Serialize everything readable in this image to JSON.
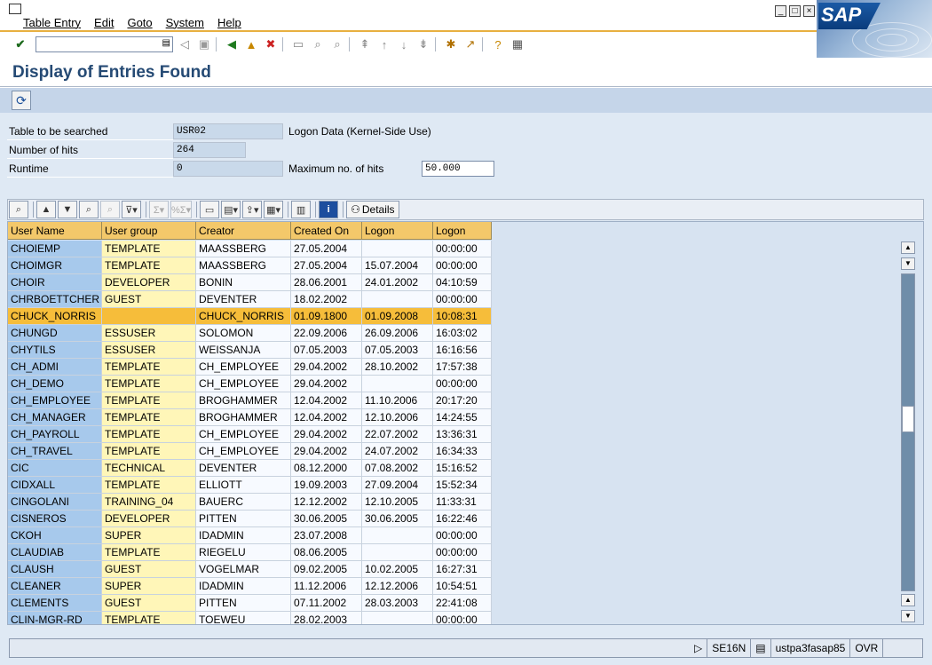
{
  "menubar": {
    "items": [
      "Table Entry",
      "Edit",
      "Goto",
      "System",
      "Help"
    ],
    "logo_text": "SAP"
  },
  "toolbar": {
    "command_value": ""
  },
  "page": {
    "title": "Display of Entries Found"
  },
  "fields": {
    "table_label": "Table to be searched",
    "table_value": "USR02",
    "table_desc": "Logon Data (Kernel-Side Use)",
    "hits_label": "Number of hits",
    "hits_value": "264",
    "runtime_label": "Runtime",
    "runtime_value": "0",
    "max_label": "Maximum no. of hits",
    "max_value": "50.000"
  },
  "alv": {
    "details_label": "Details"
  },
  "table": {
    "headers": [
      "User Name",
      "User group",
      "Creator",
      "Created On",
      "Logon",
      "Logon"
    ],
    "rows": [
      [
        "CHOIEMP",
        "TEMPLATE",
        "MAASSBERG",
        "27.05.2004",
        "",
        "00:00:00"
      ],
      [
        "CHOIMGR",
        "TEMPLATE",
        "MAASSBERG",
        "27.05.2004",
        "15.07.2004",
        "00:00:00"
      ],
      [
        "CHOIR",
        "DEVELOPER",
        "BONIN",
        "28.06.2001",
        "24.01.2002",
        "04:10:59"
      ],
      [
        "CHRBOETTCHER",
        "GUEST",
        "DEVENTER",
        "18.02.2002",
        "",
        "00:00:00"
      ],
      [
        "CHUCK_NORRIS",
        "",
        "CHUCK_NORRIS",
        "01.09.1800",
        "01.09.2008",
        "10:08:31"
      ],
      [
        "CHUNGD",
        "ESSUSER",
        "SOLOMON",
        "22.09.2006",
        "26.09.2006",
        "16:03:02"
      ],
      [
        "CHYTILS",
        "ESSUSER",
        "WEISSANJA",
        "07.05.2003",
        "07.05.2003",
        "16:16:56"
      ],
      [
        "CH_ADMI",
        "TEMPLATE",
        "CH_EMPLOYEE",
        "29.04.2002",
        "28.10.2002",
        "17:57:38"
      ],
      [
        "CH_DEMO",
        "TEMPLATE",
        "CH_EMPLOYEE",
        "29.04.2002",
        "",
        "00:00:00"
      ],
      [
        "CH_EMPLOYEE",
        "TEMPLATE",
        "BROGHAMMER",
        "12.04.2002",
        "11.10.2006",
        "20:17:20"
      ],
      [
        "CH_MANAGER",
        "TEMPLATE",
        "BROGHAMMER",
        "12.04.2002",
        "12.10.2006",
        "14:24:55"
      ],
      [
        "CH_PAYROLL",
        "TEMPLATE",
        "CH_EMPLOYEE",
        "29.04.2002",
        "22.07.2002",
        "13:36:31"
      ],
      [
        "CH_TRAVEL",
        "TEMPLATE",
        "CH_EMPLOYEE",
        "29.04.2002",
        "24.07.2002",
        "16:34:33"
      ],
      [
        "CIC",
        "TECHNICAL",
        "DEVENTER",
        "08.12.2000",
        "07.08.2002",
        "15:16:52"
      ],
      [
        "CIDXALL",
        "TEMPLATE",
        "ELLIOTT",
        "19.09.2003",
        "27.09.2004",
        "15:52:34"
      ],
      [
        "CINGOLANI",
        "TRAINING_04",
        "BAUERC",
        "12.12.2002",
        "12.10.2005",
        "11:33:31"
      ],
      [
        "CISNEROS",
        "DEVELOPER",
        "PITTEN",
        "30.06.2005",
        "30.06.2005",
        "16:22:46"
      ],
      [
        "CKOH",
        "SUPER",
        "IDADMIN",
        "23.07.2008",
        "",
        "00:00:00"
      ],
      [
        "CLAUDIAB",
        "TEMPLATE",
        "RIEGELU",
        "08.06.2005",
        "",
        "00:00:00"
      ],
      [
        "CLAUSH",
        "GUEST",
        "VOGELMAR",
        "09.02.2005",
        "10.02.2005",
        "16:27:31"
      ],
      [
        "CLEANER",
        "SUPER",
        "IDADMIN",
        "11.12.2006",
        "12.12.2006",
        "10:54:51"
      ],
      [
        "CLEMENTS",
        "GUEST",
        "PITTEN",
        "07.11.2002",
        "28.03.2003",
        "22:41:08"
      ],
      [
        "CLIN-MGR-RD",
        "TEMPLATE",
        "TOEWEU",
        "28.02.2003",
        "",
        "00:00:00"
      ]
    ],
    "selected_row": 4
  },
  "statusbar": {
    "transaction": "SE16N",
    "server": "ustpa3fasap85",
    "mode": "OVR"
  }
}
